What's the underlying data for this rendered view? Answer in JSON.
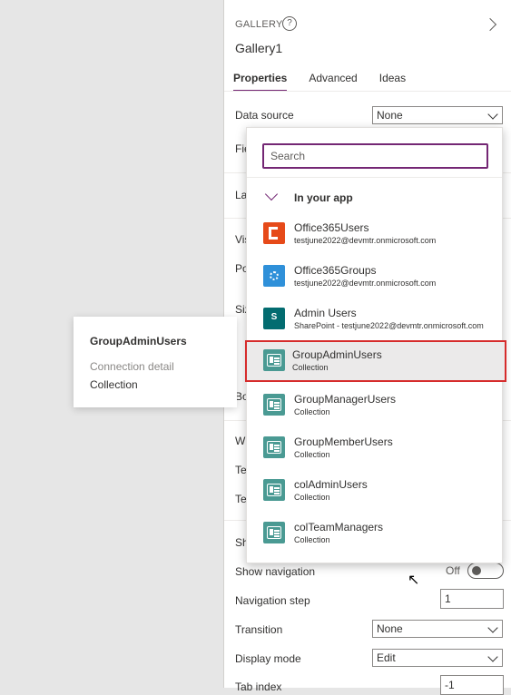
{
  "panel": {
    "kind": "GALLERY",
    "help_glyph": "?",
    "name": "Gallery1",
    "tabs": [
      {
        "label": "Properties",
        "active": true
      },
      {
        "label": "Advanced",
        "active": false
      },
      {
        "label": "Ideas",
        "active": false
      }
    ],
    "data_source": {
      "label": "Data source",
      "value": "None"
    },
    "partial_labels": [
      "Fie",
      "La",
      "Vis",
      "Po",
      "Siz",
      "Bo",
      "W",
      "Te",
      "Te",
      "Sh"
    ],
    "show_navigation": {
      "label": "Show navigation",
      "state": "Off"
    },
    "navigation_step": {
      "label": "Navigation step",
      "value": "1"
    },
    "transition": {
      "label": "Transition",
      "value": "None"
    },
    "display_mode": {
      "label": "Display mode",
      "value": "Edit"
    },
    "tab_index": {
      "label": "Tab index",
      "value": "-1"
    }
  },
  "dropdown": {
    "search_placeholder": "Search",
    "group_label": "In your app",
    "items": [
      {
        "title": "Office365Users",
        "subtitle": "testjune2022@devmtr.onmicrosoft.com",
        "icon": "office365-icon"
      },
      {
        "title": "Office365Groups",
        "subtitle": "testjune2022@devmtr.onmicrosoft.com",
        "icon": "office365-groups-icon"
      },
      {
        "title": "Admin Users",
        "subtitle": "SharePoint - testjune2022@devmtr.onmicrosoft.com",
        "icon": "sharepoint-icon"
      },
      {
        "title": "GroupAdminUsers",
        "subtitle": "Collection",
        "icon": "collection-icon"
      },
      {
        "title": "GroupManagerUsers",
        "subtitle": "Collection",
        "icon": "collection-icon"
      },
      {
        "title": "GroupMemberUsers",
        "subtitle": "Collection",
        "icon": "collection-icon"
      },
      {
        "title": "colAdminUsers",
        "subtitle": "Collection",
        "icon": "collection-icon"
      },
      {
        "title": "colTeamManagers",
        "subtitle": "Collection",
        "icon": "collection-icon"
      }
    ],
    "selected_index": 3
  },
  "tooltip": {
    "title": "GroupAdminUsers",
    "detail_label": "Connection detail",
    "detail_value": "Collection"
  },
  "colors": {
    "accent": "#742774",
    "highlight": "#d62c2c"
  }
}
